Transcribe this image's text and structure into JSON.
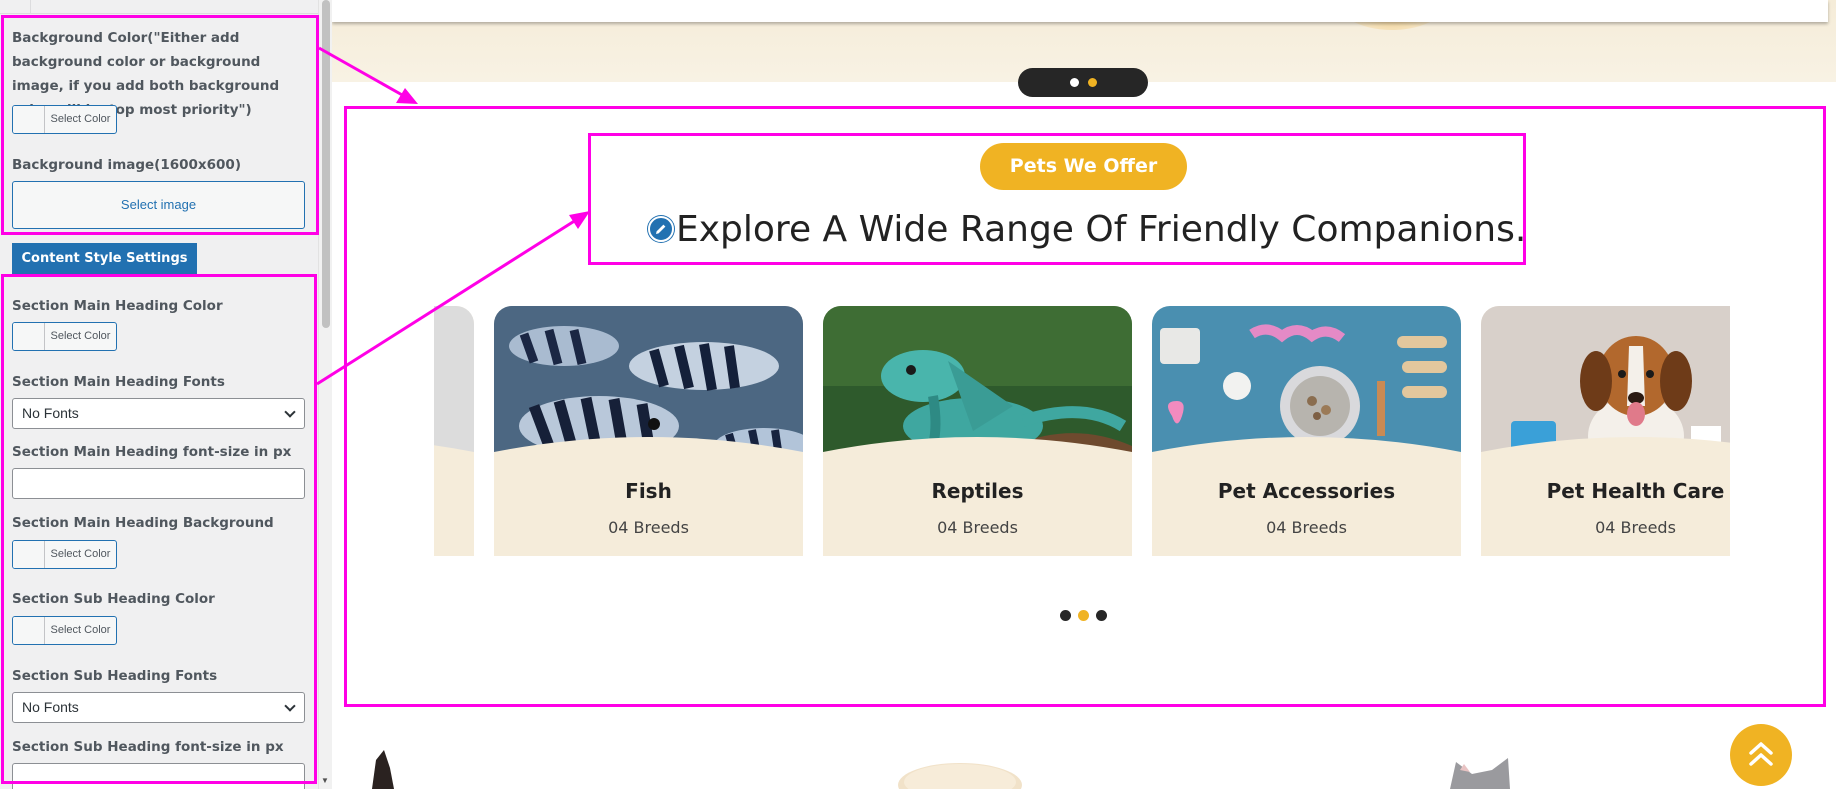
{
  "panel": {
    "bg_color_label": "Background Color(\"Either add background color or background image, if you add both background color will be top most priority\")",
    "select_color_label": "Select Color",
    "bg_image_label": "Background image(1600x600)",
    "select_image_label": "Select image",
    "content_style_tab": "Content Style Settings",
    "fields": {
      "main_heading_color": "Section Main Heading Color",
      "main_heading_fonts": "Section Main Heading Fonts",
      "main_heading_fonts_value": "No Fonts",
      "main_heading_size": "Section Main Heading font-size in px",
      "main_heading_bg": "Section Main Heading Background Color",
      "sub_heading_color": "Section Sub Heading Color",
      "sub_heading_fonts": "Section Sub Heading Fonts",
      "sub_heading_fonts_value": "No Fonts",
      "sub_heading_size": "Section Sub Heading font-size in px"
    }
  },
  "preview": {
    "tagline": "Pets We Offer",
    "heading": "Explore A Wide Range Of Friendly Companions.",
    "cards": [
      {
        "title": "Fish",
        "subtitle": "04 Breeds"
      },
      {
        "title": "Reptiles",
        "subtitle": "04 Breeds"
      },
      {
        "title": "Pet Accessories",
        "subtitle": "04 Breeds"
      },
      {
        "title": "Pet Health Care",
        "subtitle": "04 Breeds"
      }
    ],
    "hero_dots_active_index": 1,
    "carousel_dots_active_index": 1
  },
  "colors": {
    "accent": "#f0b323",
    "annotation": "#ff00e6",
    "wp_blue": "#2271b1",
    "card_bg": "#f5ecda"
  },
  "icons": [
    "edit-pencil-icon",
    "chevron-down-icon",
    "double-chevron-up-icon"
  ]
}
